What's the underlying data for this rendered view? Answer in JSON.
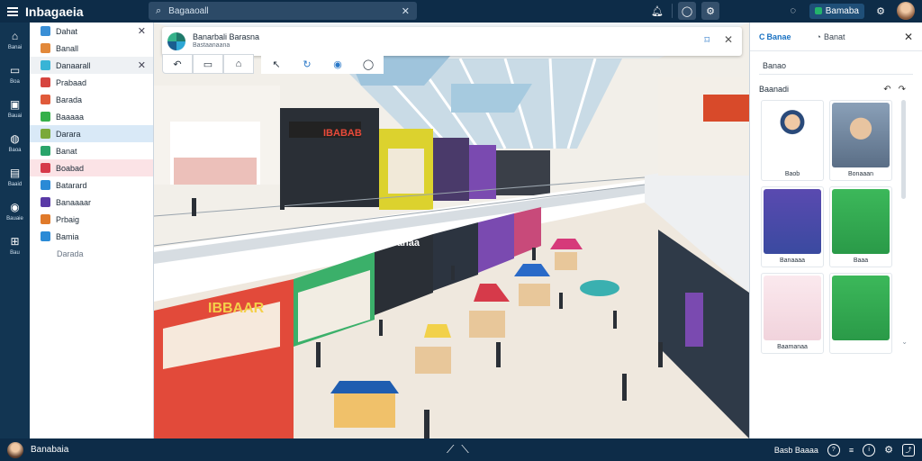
{
  "app": {
    "title": "Inbagaeia"
  },
  "search": {
    "value": "Bagaaoall",
    "placeholder": ""
  },
  "topbar": {
    "account_label": "Bamaba"
  },
  "rail": {
    "items": [
      {
        "icon": "home-icon",
        "label": "Banai"
      },
      {
        "icon": "folder-icon",
        "label": "Boa"
      },
      {
        "icon": "monitor-icon",
        "label": "Bauai"
      },
      {
        "icon": "globe-icon",
        "label": "Baoa"
      },
      {
        "icon": "document-icon",
        "label": "Baaid"
      },
      {
        "icon": "earth-icon",
        "label": "Bauaie"
      },
      {
        "icon": "storefront-icon",
        "label": "Bau"
      }
    ]
  },
  "leftpanel": {
    "items": [
      {
        "label": "Dahat",
        "color": "#3a8fd6",
        "selected": "none"
      },
      {
        "label": "Banall",
        "color": "#e2883a",
        "selected": "none"
      },
      {
        "label": "Danaarall",
        "color": "#38b4d6",
        "selected": "grey"
      },
      {
        "label": "Prabaad",
        "color": "#d6453f",
        "selected": "none"
      },
      {
        "label": "Barada",
        "color": "#e05a3a",
        "selected": "none"
      },
      {
        "label": "Baaaaa",
        "color": "#34b04a",
        "selected": "none"
      },
      {
        "label": "Darara",
        "color": "#7aa93a",
        "selected": "blue"
      },
      {
        "label": "Banat",
        "color": "#2aa46a",
        "selected": "none"
      },
      {
        "label": "Boabad",
        "color": "#d63a4a",
        "selected": "pink"
      },
      {
        "label": "Batarard",
        "color": "#2a8ad6",
        "selected": "none"
      },
      {
        "label": "Banaaaar",
        "color": "#5a3aa6",
        "selected": "none"
      },
      {
        "label": "Prbaig",
        "color": "#e07a2a",
        "selected": "none"
      },
      {
        "label": "Bamia",
        "color": "#2a8ad6",
        "selected": "none"
      }
    ],
    "footer": "Darada"
  },
  "infocard": {
    "title": "Banarbali Barasna",
    "subtitle": "Bastaanaana"
  },
  "scene": {
    "signs": [
      "IBABAB",
      "Banaa",
      "IBBAAR"
    ]
  },
  "rightpanel": {
    "tab1": "Banae",
    "tab2": "Banat",
    "field_value": "Banao",
    "section_title": "Baanadi",
    "tiles": [
      {
        "caption": "Baob",
        "art": "character-figurine"
      },
      {
        "caption": "Bonaaan",
        "art": "portrait"
      },
      {
        "caption": "Banaaaa",
        "art": "product-box"
      },
      {
        "caption": "Baaa",
        "art": "device"
      },
      {
        "caption": "Baamanaa",
        "art": "cosmetics"
      },
      {
        "caption": "",
        "art": "tool-kit"
      }
    ]
  },
  "bottombar": {
    "username": "Banabaia",
    "status_label": "Basb Baaaa"
  },
  "colors": {
    "topbar": "#0d2c48",
    "accent": "#1a72c3"
  }
}
